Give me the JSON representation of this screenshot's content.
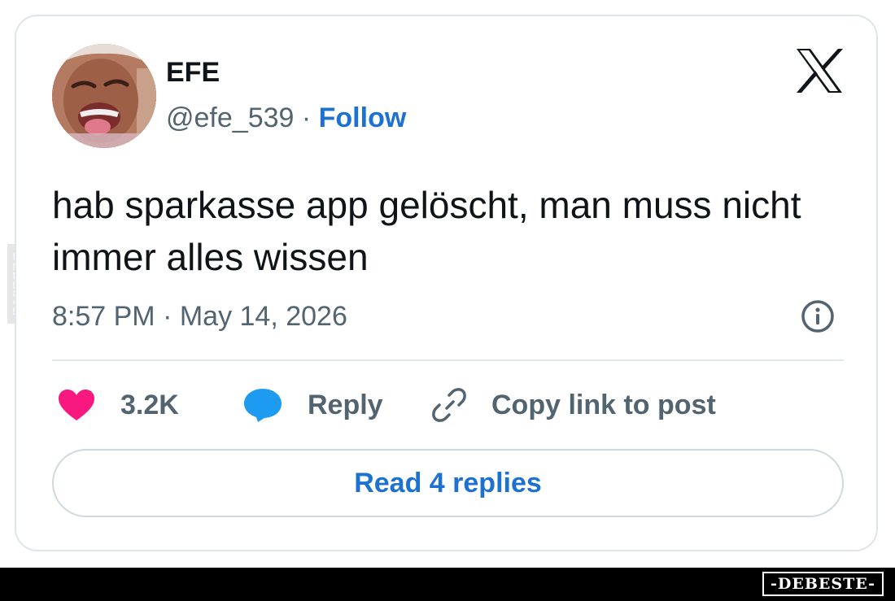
{
  "watermark_side": "DEBESTE",
  "tweet": {
    "author_name": "EFE",
    "handle": "@efe_539",
    "separator": " · ",
    "follow_label": "Follow",
    "text": "hab sparkasse app gelöscht, man muss nicht immer alles wissen",
    "timestamp": "8:57 PM · May 14, 2026",
    "platform_icon": "x-logo-icon",
    "actions": {
      "like_count": "3.2K",
      "reply_label": "Reply",
      "copy_label": "Copy link to post"
    },
    "read_replies_label": "Read 4 replies"
  },
  "footer": {
    "logo_text": "-DEBESTE-"
  },
  "colors": {
    "accent_blue": "#1d72d1",
    "like_pink": "#f91880",
    "reply_blue": "#1d9bf0",
    "muted_text": "#536471",
    "border": "#dfe4e8"
  }
}
